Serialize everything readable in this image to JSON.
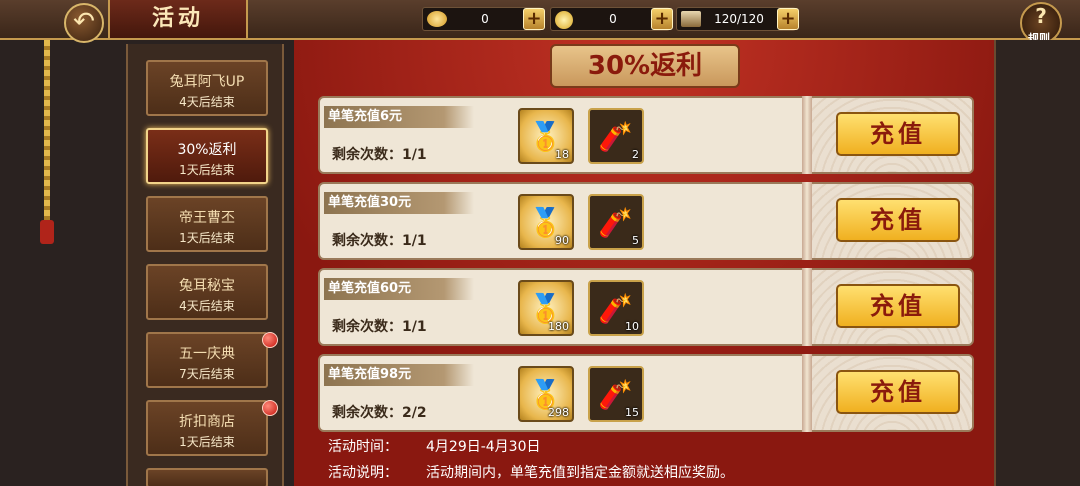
{
  "header": {
    "title": "活动",
    "back_icon": "↶",
    "resources": [
      {
        "icon": "gold-ingot-icon",
        "value": "0"
      },
      {
        "icon": "coin-icon",
        "value": "0"
      },
      {
        "icon": "stamina-icon",
        "value": "120/120"
      }
    ],
    "plus": "+",
    "rules_symbol": "?",
    "rules_label": "规则"
  },
  "sidebar": {
    "items": [
      {
        "title": "兔耳阿飞UP",
        "sub": "4天后结束",
        "active": false,
        "dot": false
      },
      {
        "title": "30%返利",
        "sub": "1天后结束",
        "active": true,
        "dot": false
      },
      {
        "title": "帝王曹丕",
        "sub": "1天后结束",
        "active": false,
        "dot": false
      },
      {
        "title": "兔耳秘宝",
        "sub": "4天后结束",
        "active": false,
        "dot": false
      },
      {
        "title": "五一庆典",
        "sub": "7天后结束",
        "active": false,
        "dot": true
      },
      {
        "title": "折扣商店",
        "sub": "1天后结束",
        "active": false,
        "dot": true
      }
    ]
  },
  "main": {
    "banner": "30%返利",
    "remain_label": "剩余次数：",
    "button_label": "充值",
    "rows": [
      {
        "title": "单笔充值6元",
        "remain": "1/1",
        "ingots": "18",
        "firecrackers": "2"
      },
      {
        "title": "单笔充值30元",
        "remain": "1/1",
        "ingots": "90",
        "firecrackers": "5"
      },
      {
        "title": "单笔充值60元",
        "remain": "1/1",
        "ingots": "180",
        "firecrackers": "10"
      },
      {
        "title": "单笔充值98元",
        "remain": "2/2",
        "ingots": "298",
        "firecrackers": "15"
      }
    ],
    "footer": {
      "time_label": "活动时间：",
      "time_value": "4月29日-4月30日",
      "desc_label": "活动说明：",
      "desc_value": "活动期间内，单笔充值到指定金额就送相应奖励。"
    }
  },
  "colors": {
    "accent": "#a4231a",
    "gold": "#f0b020",
    "text_dark": "#3a2a1a"
  }
}
